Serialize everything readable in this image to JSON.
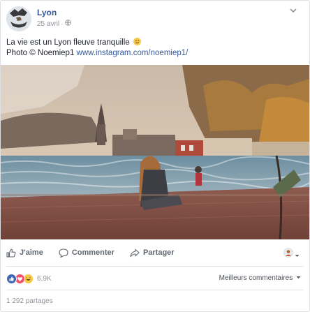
{
  "post": {
    "page_name": "Lyon",
    "date": "25 avril",
    "meta_separator": "·",
    "privacy_icon": "globe-icon",
    "options_icon": "chevron-down-icon",
    "text_line1": "La vie est un Lyon fleuve tranquille",
    "text_line2_prefix": "Photo © Noemiep1",
    "link": "www.instagram.com/noemiep1/",
    "emoji": "smiley-emoji"
  },
  "photo": {
    "description_icon": "photo"
  },
  "actions": {
    "like_label": "J'aime",
    "comment_label": "Commenter",
    "share_label": "Partager",
    "like_icon": "thumbs-up-icon",
    "comment_icon": "speech-bubble-icon",
    "share_icon": "share-arrow-icon",
    "audience_icon": "avatar-dropdown-icon"
  },
  "reactions": {
    "count": "6,9K",
    "types": [
      "like",
      "love",
      "haha"
    ],
    "best_comments_label": "Meilleurs commentaires"
  },
  "footer": {
    "shares_label": "1 292 partages"
  },
  "colors": {
    "link": "#365899",
    "like": "#4267b2",
    "love": "#f25268",
    "haha": "#f7c948",
    "muted": "#90949c"
  }
}
